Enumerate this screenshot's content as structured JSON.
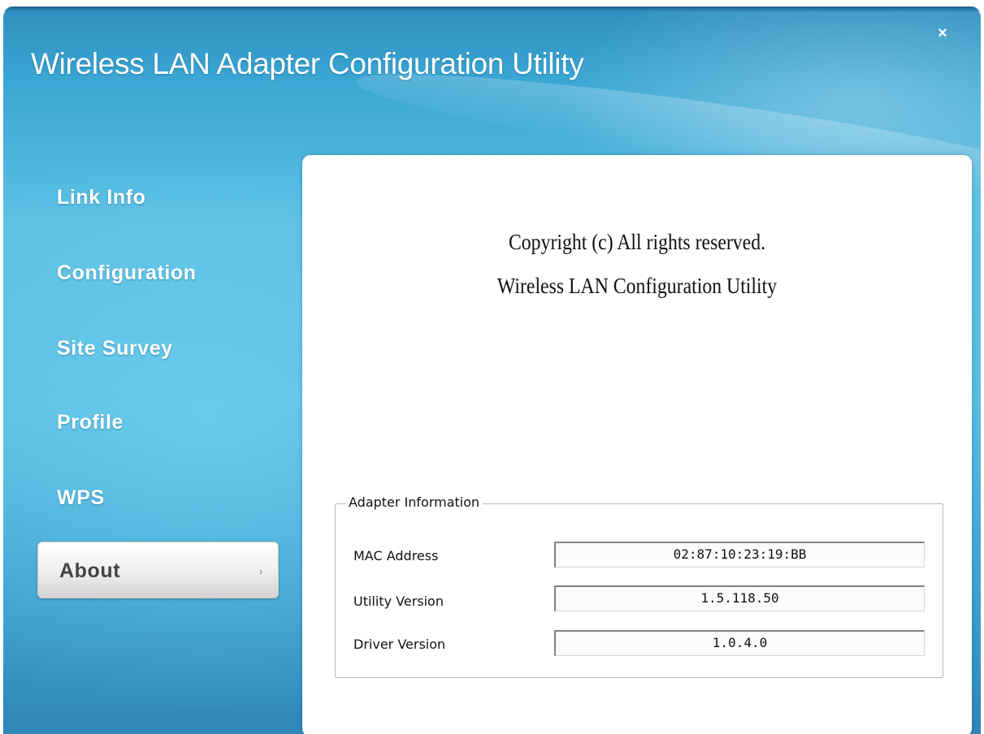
{
  "window": {
    "title": "Wireless LAN Adapter Configuration Utility",
    "close_glyph": "×"
  },
  "nav": {
    "items": [
      {
        "label": "Link Info",
        "active": false
      },
      {
        "label": "Configuration",
        "active": false
      },
      {
        "label": "Site Survey",
        "active": false
      },
      {
        "label": "Profile",
        "active": false
      },
      {
        "label": "WPS",
        "active": false
      },
      {
        "label": "About",
        "active": true
      }
    ],
    "active_arrow": "›"
  },
  "about": {
    "copyright_line": "Copyright (c)  All rights reserved.",
    "product_line": "Wireless LAN Configuration Utility",
    "adapter_info": {
      "legend": "Adapter Information",
      "rows": [
        {
          "label": "MAC Address",
          "value": "02:87:10:23:19:BB"
        },
        {
          "label": "Utility Version",
          "value": "1.5.118.50"
        },
        {
          "label": "Driver Version",
          "value": "1.0.4.0"
        }
      ]
    }
  },
  "colors": {
    "background_blue": "#4fb6df",
    "panel": "#ffffff",
    "active_nav_text": "#444444"
  },
  "icons": {
    "close": "close-icon",
    "nav_arrow": "chevron-right-icon"
  }
}
